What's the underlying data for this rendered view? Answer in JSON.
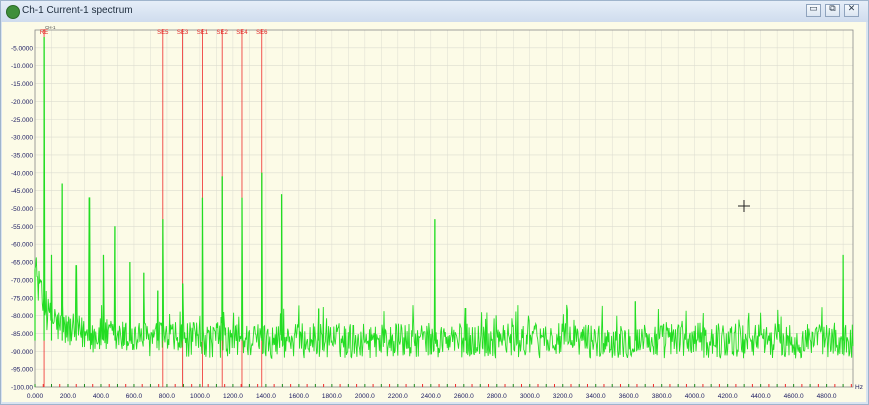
{
  "window": {
    "title": "Ch-1 Current-1 spectrum",
    "buttons": {
      "minimize": "▭",
      "restore": "⧉",
      "close": "✕"
    }
  },
  "colors": {
    "plot_background": "#fcfbe7",
    "grid": "#dcdcd0",
    "spectrum": "#22dd22",
    "marker": "#ee2a2a",
    "axis_text": "#1a1a60",
    "marker_text": "#e02020"
  },
  "chart_data": {
    "type": "line",
    "title": "",
    "xlabel": "",
    "ylabel": "",
    "x_unit": "Hz",
    "xlim": [
      0,
      4960
    ],
    "ylim": [
      -100,
      0
    ],
    "x_ticks": [
      "0.000",
      "200.0",
      "400.0",
      "600.0",
      "800.0",
      "1000.0",
      "1200.0",
      "1400.0",
      "1600.0",
      "1800.0",
      "2000.0",
      "2200.0",
      "2400.0",
      "2600.0",
      "2800.0",
      "3000.0",
      "3200.0",
      "3400.0",
      "3600.0",
      "3800.0",
      "4000.0",
      "4200.0",
      "4400.0",
      "4600.0",
      "4800.0"
    ],
    "y_ticks": [
      "-5.0000",
      "-10.000",
      "-15.000",
      "-20.000",
      "-25.000",
      "-30.000",
      "-35.000",
      "-40.000",
      "-45.000",
      "-50.000",
      "-55.000",
      "-60.000",
      "-65.000",
      "-70.000",
      "-75.000",
      "-80.000",
      "-85.000",
      "-90.000",
      "-95.000",
      "-100.00"
    ],
    "grid": true,
    "fundamental_label": "CH-1",
    "noise_floor_db": -87,
    "markers": [
      {
        "label": "RE",
        "x": 55
      },
      {
        "label": "SE5",
        "x": 775
      },
      {
        "label": "SE3",
        "x": 895
      },
      {
        "label": "SE1",
        "x": 1015
      },
      {
        "label": "SE2",
        "x": 1135
      },
      {
        "label": "SE4",
        "x": 1255
      },
      {
        "label": "SE6",
        "x": 1375
      }
    ],
    "peaks": [
      {
        "x": 0,
        "y": -67
      },
      {
        "x": 55,
        "y": -2
      },
      {
        "x": 100,
        "y": -63
      },
      {
        "x": 165,
        "y": -43
      },
      {
        "x": 250,
        "y": -66
      },
      {
        "x": 330,
        "y": -47
      },
      {
        "x": 415,
        "y": -63
      },
      {
        "x": 485,
        "y": -55
      },
      {
        "x": 575,
        "y": -65
      },
      {
        "x": 660,
        "y": -68
      },
      {
        "x": 745,
        "y": -73
      },
      {
        "x": 775,
        "y": -53
      },
      {
        "x": 895,
        "y": -71
      },
      {
        "x": 1015,
        "y": -47
      },
      {
        "x": 1135,
        "y": -41
      },
      {
        "x": 1255,
        "y": -47
      },
      {
        "x": 1375,
        "y": -40
      },
      {
        "x": 1495,
        "y": -46
      },
      {
        "x": 1720,
        "y": -78
      },
      {
        "x": 2425,
        "y": -53
      },
      {
        "x": 2610,
        "y": -78
      },
      {
        "x": 3640,
        "y": -76
      },
      {
        "x": 4900,
        "y": -63
      }
    ]
  }
}
